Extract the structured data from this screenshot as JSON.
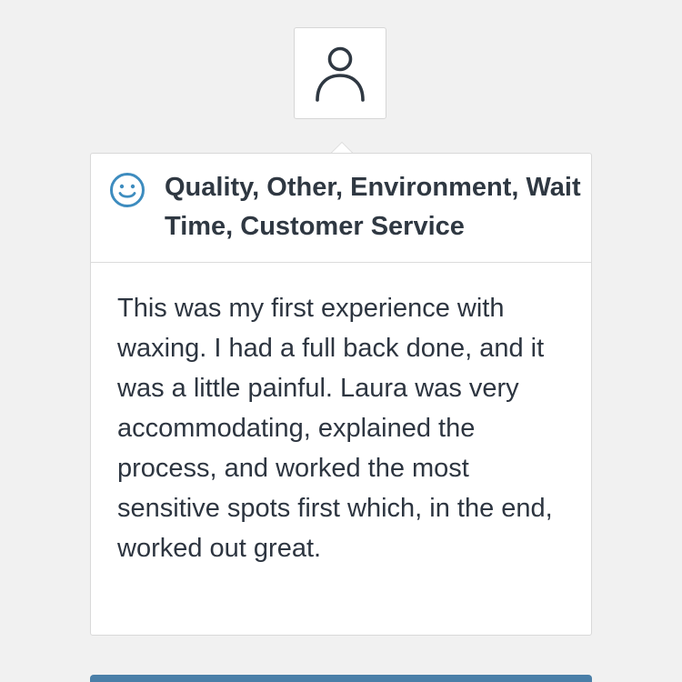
{
  "review": {
    "categories_title": "Quality, Other, Environment, Wait Time, Customer Service",
    "sentiment_icon": "smile-icon",
    "body": "This was my first experience with waxing. I had a full back done, and it was a little painful. Laura was very accommodating, explained the process, and worked the most sensitive spots first which, in the end, worked out great."
  },
  "avatar": {
    "icon": "user-icon"
  },
  "colors": {
    "background": "#f1f1f1",
    "accent": "#3d8cbf",
    "text": "#2d3540",
    "action_bar": "#4a7fa8"
  }
}
